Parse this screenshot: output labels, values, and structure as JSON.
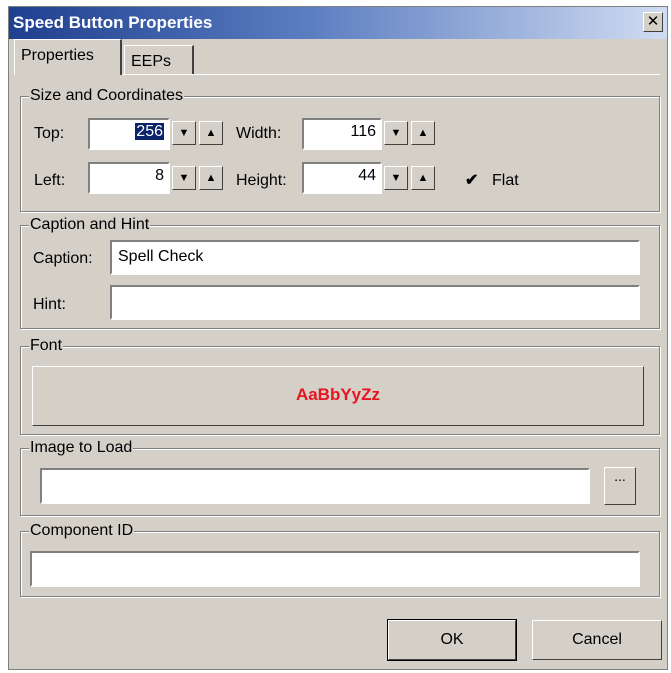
{
  "window": {
    "title": "Speed Button Properties",
    "close_glyph": "✕"
  },
  "tabs": [
    {
      "label": "Properties"
    },
    {
      "label": "EEPs"
    }
  ],
  "size_group": {
    "legend": "Size and Coordinates",
    "top": {
      "label": "Top:",
      "value": "256"
    },
    "width": {
      "label": "Width:",
      "value": "116"
    },
    "left": {
      "label": "Left:",
      "value": "8"
    },
    "height": {
      "label": "Height:",
      "value": "44"
    },
    "flat": {
      "label": "Flat",
      "checked": true,
      "mark": "✔"
    }
  },
  "caption_group": {
    "legend": "Caption and Hint",
    "caption": {
      "label": "Caption:",
      "value": "Spell Check"
    },
    "hint": {
      "label": "Hint:",
      "value": ""
    }
  },
  "font_group": {
    "legend": "Font",
    "preview": "AaBbYyZz",
    "preview_color": "#e8141e"
  },
  "image_group": {
    "legend": "Image to Load",
    "value": "",
    "browse": "..."
  },
  "component_group": {
    "legend": "Component ID",
    "value": ""
  },
  "buttons": {
    "ok": "OK",
    "cancel": "Cancel"
  },
  "icons": {
    "down": "down-arrow-icon",
    "up": "up-arrow-icon",
    "check": "checkmark-icon",
    "close": "close-icon"
  },
  "colors": {
    "title_bar_start": "#1f3f8f",
    "dialog_bg": "#d4d0c8"
  }
}
